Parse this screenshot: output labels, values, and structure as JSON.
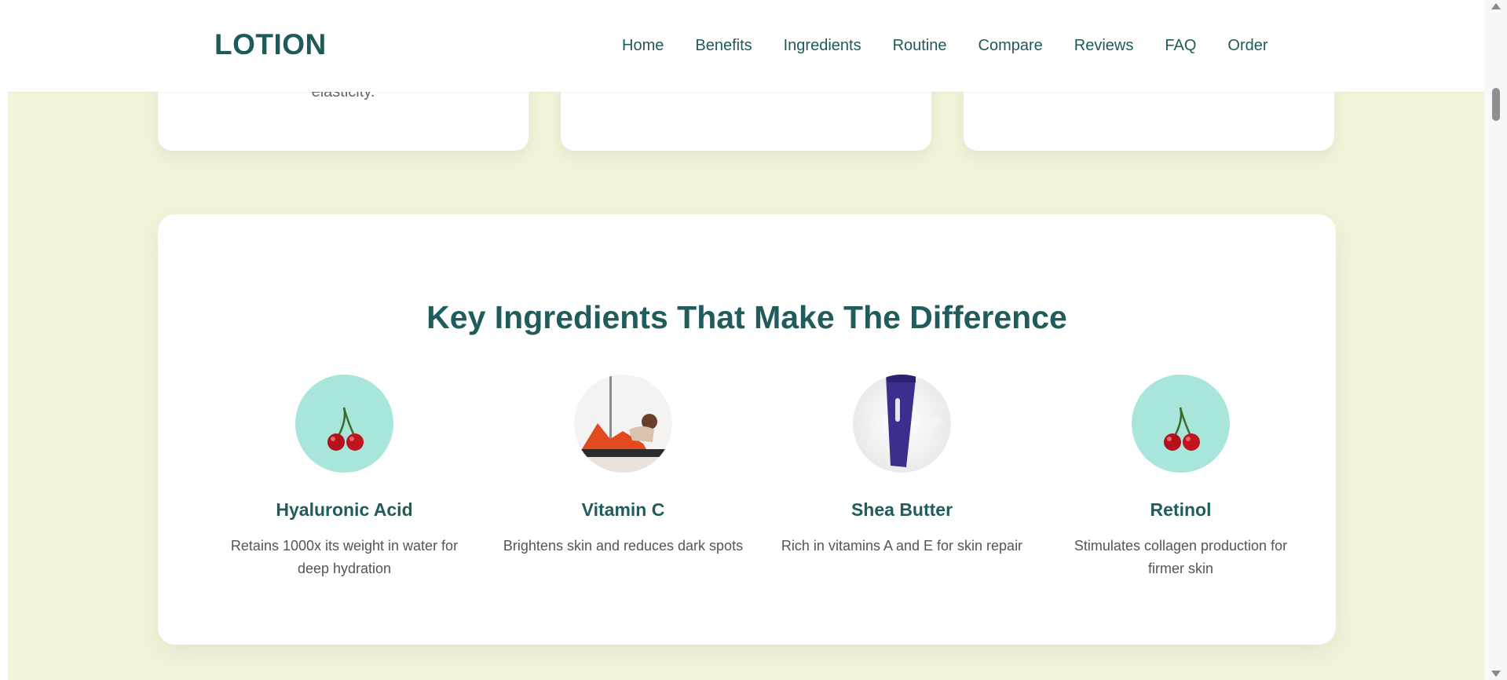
{
  "header": {
    "logo": "LOTION",
    "nav": [
      "Home",
      "Benefits",
      "Ingredients",
      "Routine",
      "Compare",
      "Reviews",
      "FAQ",
      "Order"
    ]
  },
  "benefit_cards": {
    "items": [
      {
        "text": "elasticity."
      },
      {
        "text": ""
      },
      {
        "text": ""
      }
    ]
  },
  "ingredients": {
    "title": "Key Ingredients That Make The Difference",
    "items": [
      {
        "name": "Hyaluronic Acid",
        "desc": "Retains 1000x its weight in water for deep hydration",
        "image": "cherries-image"
      },
      {
        "name": "Vitamin C",
        "desc": "Brightens skin and reduces dark spots",
        "image": "woman-exercise-image"
      },
      {
        "name": "Shea Butter",
        "desc": "Rich in vitamins A and E for skin repair",
        "image": "lotion-tube-image"
      },
      {
        "name": "Retinol",
        "desc": "Stimulates collagen production for firmer skin",
        "image": "cherries-image"
      }
    ]
  },
  "colors": {
    "brand": "#1f5a5b",
    "page_bg": "#f3f3da",
    "card_bg": "#ffffff",
    "mint": "#a8e6db"
  }
}
